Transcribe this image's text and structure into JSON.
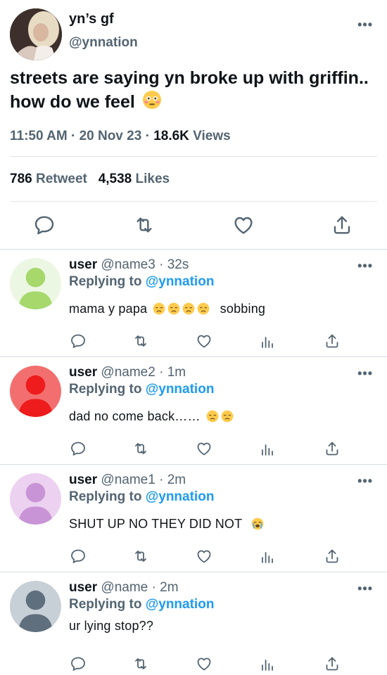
{
  "tweet": {
    "author_name": "yn’s gf",
    "author_handle": "@ynnation",
    "text": "streets are saying yn broke up with griffin.. how do we feel",
    "time": "11:50 AM",
    "date": "20 Nov 23",
    "views_count": "18.6K",
    "views_label": "Views",
    "retweets_count": "786",
    "retweets_label": "Retweet",
    "likes_count": "4,538",
    "likes_label": "Likes"
  },
  "replies": [
    {
      "name": "user",
      "handle": "@name3",
      "time": "32s",
      "replying_prefix": "Replying to",
      "replying_to": "@ynnation",
      "text": "mama y papa",
      "text_after": "sobbing",
      "avatar_color": "#a6d86c",
      "emoji": "disappointed-face"
    },
    {
      "name": "user",
      "handle": "@name2",
      "time": "1m",
      "replying_prefix": "Replying to",
      "replying_to": "@ynnation",
      "text": "dad no come back……",
      "avatar_color": "#ee1c1c",
      "emoji": "disappointed-face"
    },
    {
      "name": "user",
      "handle": "@name1",
      "time": "2m",
      "replying_prefix": "Replying to",
      "replying_to": "@ynnation",
      "text": "SHUT UP NO THEY DID NOT",
      "avatar_color": "#c894d6",
      "emoji": "loudly-crying-face"
    },
    {
      "name": "user",
      "handle": "@name",
      "time": "2m",
      "replying_prefix": "Replying to",
      "replying_to": "@ynnation",
      "text": "ur lying stop??",
      "avatar_color": "#5f6f7d"
    }
  ],
  "colors": {
    "link": "#1d9bf0",
    "secondary_text": "#536471",
    "divider": "#d7dde2"
  },
  "icons": [
    "reply-icon",
    "retweet-icon",
    "like-icon",
    "views-icon",
    "share-icon",
    "more-icon"
  ]
}
